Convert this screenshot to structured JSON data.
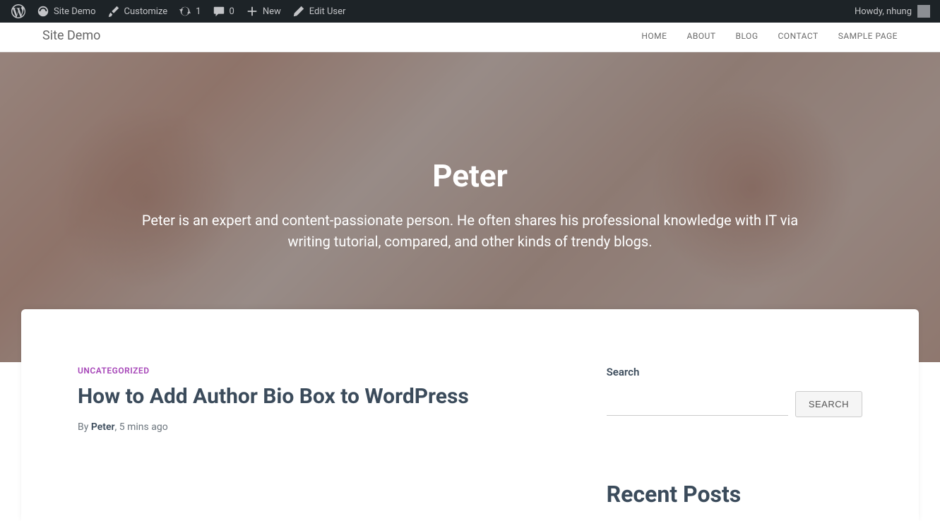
{
  "adminbar": {
    "site_name": "Site Demo",
    "customize": "Customize",
    "updates_count": "1",
    "comments_count": "0",
    "new_label": "New",
    "edit_user": "Edit User",
    "howdy": "Howdy, nhung"
  },
  "header": {
    "site_title": "Site Demo",
    "nav": [
      "HOME",
      "ABOUT",
      "BLOG",
      "CONTACT",
      "SAMPLE PAGE"
    ]
  },
  "hero": {
    "title": "Peter",
    "description": "Peter is an expert and content-passionate person. He often shares his professional knowledge with IT via writing tutorial, compared, and other kinds of trendy blogs."
  },
  "post": {
    "category": "UNCATEGORIZED",
    "title": "How to Add Author Bio Box to WordPress",
    "by_label": "By ",
    "author": "Peter",
    "separator": ", ",
    "time_ago": "5 mins ago"
  },
  "sidebar": {
    "search_label": "Search",
    "search_button": "SEARCH",
    "recent_posts_title": "Recent Posts"
  }
}
